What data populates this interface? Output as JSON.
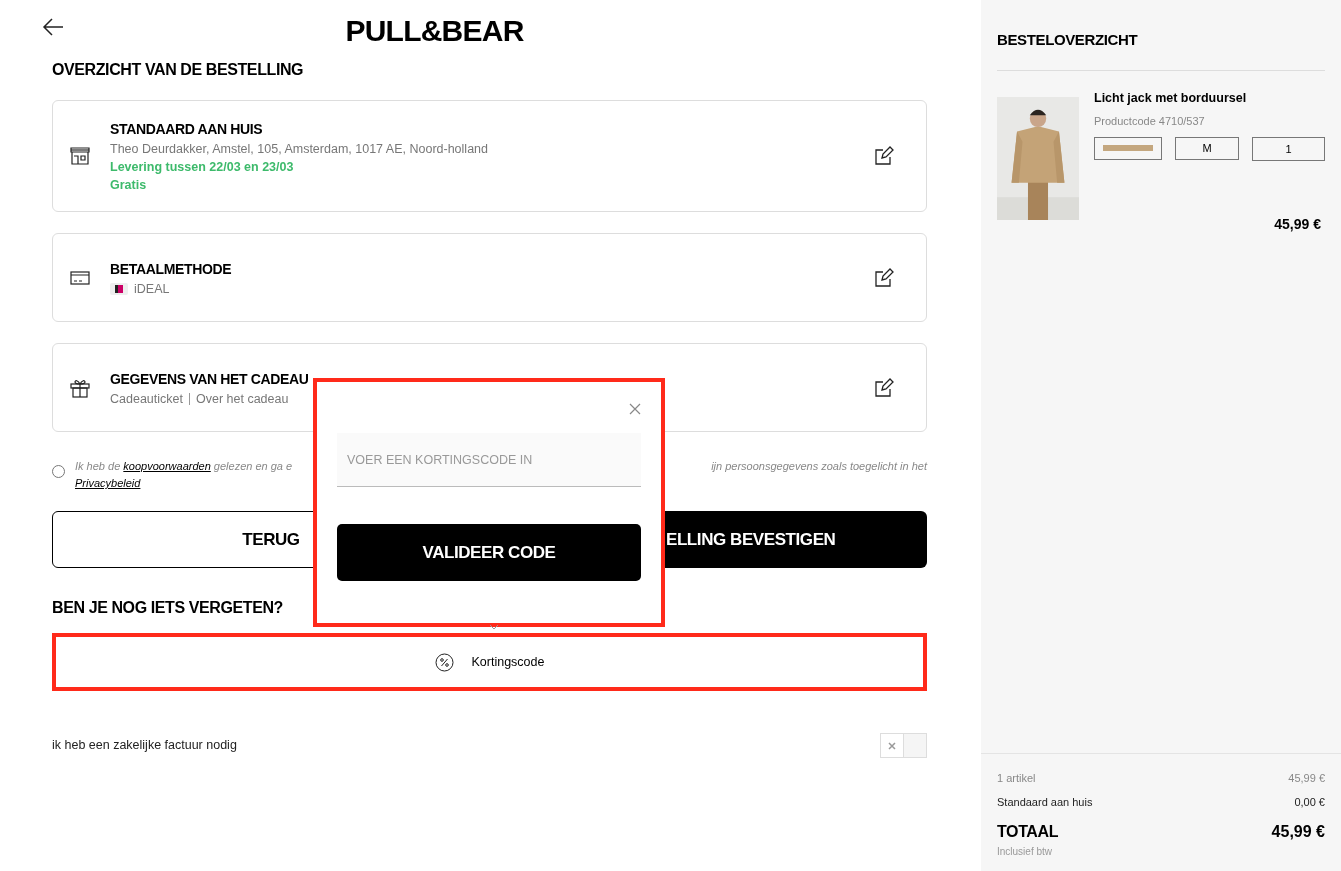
{
  "header": {
    "logo": "PULL&BEAR"
  },
  "main": {
    "title": "OVERZICHT VAN DE BESTELLING",
    "cards": [
      {
        "kind": "shipping",
        "title": "STANDAARD AAN HUIS",
        "lines": [
          "Theo Deurdakker, Amstel, 105, Amsterdam, 1017 AE, Noord-holland"
        ],
        "highlights": [
          "Levering tussen 22/03 en 23/03",
          "Gratis"
        ]
      },
      {
        "kind": "payment",
        "title": "BETAALMETHODE",
        "lines": [
          "iDEAL"
        ]
      },
      {
        "kind": "gift",
        "title": "GEGEVENS VAN HET CADEAU",
        "lines": [
          "Cadeauticket",
          "Over het cadeau"
        ]
      }
    ],
    "consent": {
      "checked": false,
      "before": "Ik heb de ",
      "link": "koopvoorwaarden",
      "after": " gelezen en ga e",
      "right": "ijn persoonsgegevens zoals toegelicht in het",
      "link2": "Privacybeleid"
    },
    "back_button": "TERUG",
    "confirm_button": "ELLING BEVESTIGEN",
    "forgot_title": "BEN JE NOG IETS VERGETEN?",
    "discount_bar": {
      "label": "Kortingscode",
      "highlighted": true
    },
    "business_invoice": {
      "label": "ik heb een zakelijke factuur nodig",
      "on": false
    }
  },
  "popup": {
    "placeholder": "VOER EEN KORTINGSCODE IN",
    "button": "VALIDEER CODE",
    "highlighted": true
  },
  "sidebar": {
    "title": "BESTELOVERZICHT",
    "item": {
      "name": "Licht jack met borduursel",
      "code": "Productcode 4710/537",
      "color": "#c4a77f",
      "size": "M",
      "quantity": "1",
      "price": "45,99 €"
    },
    "summary": [
      {
        "label": "1 artikel",
        "value": "45,99 €",
        "kind": "muted"
      },
      {
        "label": "Standaard aan huis",
        "value": "0,00 €",
        "kind": "normal"
      }
    ],
    "total": {
      "label": "TOTAAL",
      "value": "45,99 €",
      "note": "Inclusief btw"
    }
  }
}
